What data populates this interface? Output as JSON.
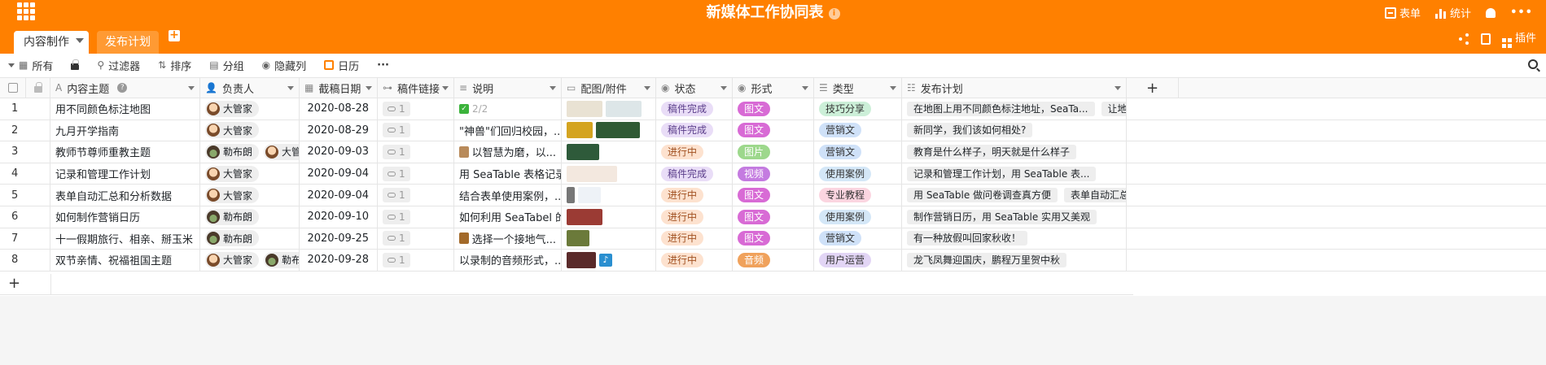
{
  "header": {
    "title": "新媒体工作协同表",
    "form_label": "表单",
    "stats_label": "统计",
    "plugin_label": "插件"
  },
  "tabs": [
    {
      "label": "内容制作"
    },
    {
      "label": "发布计划"
    }
  ],
  "toolbar": {
    "view": "所有",
    "filter": "过滤器",
    "sort": "排序",
    "group": "分组",
    "hide": "隐藏列",
    "calendar": "日历"
  },
  "columns": [
    {
      "label": "内容主题"
    },
    {
      "label": "负责人"
    },
    {
      "label": "截稿日期"
    },
    {
      "label": "稿件链接"
    },
    {
      "label": "说明"
    },
    {
      "label": "配图/附件"
    },
    {
      "label": "状态"
    },
    {
      "label": "形式"
    },
    {
      "label": "类型"
    },
    {
      "label": "发布计划"
    }
  ],
  "rows": [
    {
      "n": "1",
      "topic": "用不同颜色标注地图",
      "owners": [
        "大管家"
      ],
      "date": "2020-08-28",
      "link": "1",
      "desc": "2/2",
      "status": "稿件完成",
      "form": "图文",
      "type": "技巧分享",
      "plans": [
        "在地图上用不同颜色标注地址，SeaTa...",
        "让地图可视"
      ]
    },
    {
      "n": "2",
      "topic": "九月开学指南",
      "owners": [
        "大管家"
      ],
      "date": "2020-08-29",
      "link": "1",
      "desc": "\"神兽\"们回归校园，...",
      "status": "稿件完成",
      "form": "图文",
      "type": "营销文",
      "plans": [
        "新同学，我们该如何相处?"
      ]
    },
    {
      "n": "3",
      "topic": "教师节尊师重教主题",
      "owners": [
        "勒布朗",
        "大管家"
      ],
      "date": "2020-09-03",
      "link": "1",
      "desc": "以智慧为磨，以...",
      "status": "进行中",
      "form": "图片",
      "type": "营销文",
      "plans": [
        "教育是什么样子，明天就是什么样子"
      ]
    },
    {
      "n": "4",
      "topic": "记录和管理工作计划",
      "owners": [
        "大管家"
      ],
      "date": "2020-09-04",
      "link": "1",
      "desc": "用 SeaTable 表格记录...",
      "status": "稿件完成",
      "form": "视频",
      "type": "使用案例",
      "plans": [
        "记录和管理工作计划，用 SeaTable 表..."
      ]
    },
    {
      "n": "5",
      "topic": "表单自动汇总和分析数据",
      "owners": [
        "大管家"
      ],
      "date": "2020-09-04",
      "link": "1",
      "desc": "结合表单使用案例，...",
      "status": "进行中",
      "form": "图文",
      "type": "专业教程",
      "plans": [
        "用 SeaTable 做问卷调查真方便",
        "表单自动汇总数据到"
      ]
    },
    {
      "n": "6",
      "topic": "如何制作营销日历",
      "owners": [
        "勒布朗"
      ],
      "date": "2020-09-10",
      "link": "1",
      "desc": "如何利用 SeaTabel 的...",
      "status": "进行中",
      "form": "图文",
      "type": "使用案例",
      "plans": [
        "制作营销日历，用 SeaTable 实用又美观"
      ]
    },
    {
      "n": "7",
      "topic": "十一假期旅行、相亲、掰玉米",
      "owners": [
        "勒布朗"
      ],
      "date": "2020-09-25",
      "link": "1",
      "desc": "选择一个接地气...",
      "status": "进行中",
      "form": "图文",
      "type": "营销文",
      "plans": [
        "有一种放假叫回家秋收！"
      ]
    },
    {
      "n": "8",
      "topic": "双节亲情、祝福祖国主题",
      "owners": [
        "大管家",
        "勒布朗"
      ],
      "date": "2020-09-28",
      "link": "1",
      "desc": "以录制的音频形式，...",
      "status": "进行中",
      "form": "音频",
      "type": "用户运营",
      "plans": [
        "龙飞凤舞迎国庆，鹏程万里贺中秋"
      ]
    }
  ],
  "colors": {
    "brand": "#ff8000",
    "status_done": "#eae0f7",
    "status_progress": "#fde4d0",
    "form_pink": "#d96ad6",
    "form_green": "#9bd78a",
    "form_orange": "#f2a35c"
  }
}
